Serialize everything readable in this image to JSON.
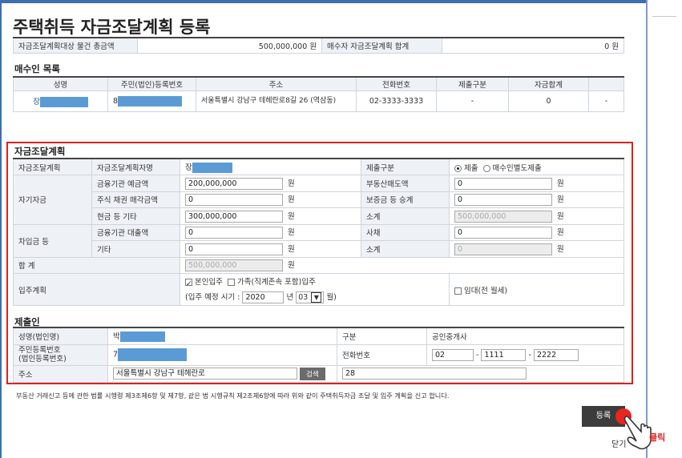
{
  "page": {
    "title": "주택취득 자금조달계획 등록"
  },
  "summary": {
    "total_label": "자금조달계획대상 물건 총금액",
    "total_value": "500,000,000 원",
    "buyer_sum_label": "매수자 자금조달계획 합계",
    "buyer_sum_value": "0 원"
  },
  "buyers": {
    "section_title": "매수인 목록",
    "headers": [
      "성명",
      "주민(법인)등록번호",
      "주소",
      "전화번호",
      "제출구분",
      "자금합계",
      ""
    ],
    "row": {
      "name": "장",
      "rrn": "8",
      "address": "서울특별시 강남구 테헤란로8길 26 (역삼동)",
      "phone": "02-3333-3333",
      "submit_type": "-",
      "fund_sum": "0",
      "extra": "-"
    }
  },
  "plan": {
    "section_title": "자금조달계획",
    "plan_label": "자금조달계획",
    "writer_label": "자금조달계획자명",
    "writer_value": "장",
    "submit_label": "제출구분",
    "submit_opt1": "제출",
    "submit_opt2": "매수인별도제출",
    "own_label": "자기자금",
    "deposit_label": "금융기관 예금액",
    "deposit_value": "200,000,000",
    "realestate_label": "부동산매도액",
    "realestate_value": "0",
    "stock_label": "주식 채권 매각금액",
    "stock_value": "0",
    "lease_label": "보증금 등 승계",
    "lease_value": "0",
    "cash_label": "현금 등 기타",
    "cash_value": "300,000,000",
    "own_subtotal_label": "소계",
    "own_subtotal_value": "500,000,000",
    "borrow_label": "차입금 등",
    "loan_label": "금융기관 대출액",
    "loan_value": "0",
    "private_label": "사채",
    "private_value": "0",
    "etc_label": "기타",
    "etc_value": "0",
    "borrow_subtotal_label": "소계",
    "borrow_subtotal_value": "0",
    "total_label": "합 계",
    "total_value": "500,000,000",
    "unit": "원",
    "move_label": "입주계획",
    "move_opt1": "본인입주",
    "move_opt2": "가족(직계존속 포함)입주",
    "move_opt3": "임대(전 월세)",
    "move_prefix": "(입주 예정 시기 :",
    "move_year": "2020",
    "year_unit": "년",
    "move_month": "03",
    "month_unit": "월)"
  },
  "submitter": {
    "section_title": "제출인",
    "name_label": "성명(법인명)",
    "name_value": "박",
    "type_label": "구분",
    "type_value": "공인중개사",
    "rrn_label": "주민등록번호\n(법인등록번호)",
    "rrn_value": "7",
    "phone_label": "전화번호",
    "phone1": "02",
    "phone2": "1111",
    "phone3": "2222",
    "addr_label": "주소",
    "addr_value": "서울특별시 강남구 테헤란로",
    "search_label": "검색",
    "addr_detail": "28"
  },
  "footer": {
    "notice": "부동산 거래신고 등에 관한 법률 시행령 제3조제6항 및 제7항, 같은 법 시행규칙 제2조제6항에 따라 위와 같이 주택취득자금 조달 및 입주 계획을 신고 합니다.",
    "register_label": "등록",
    "click_label": "클릭",
    "close_label": "닫기"
  },
  "colors": {
    "accent": "#3d6fb0",
    "highlight_border": "#e02020",
    "redaction": "#5b9bd5"
  }
}
